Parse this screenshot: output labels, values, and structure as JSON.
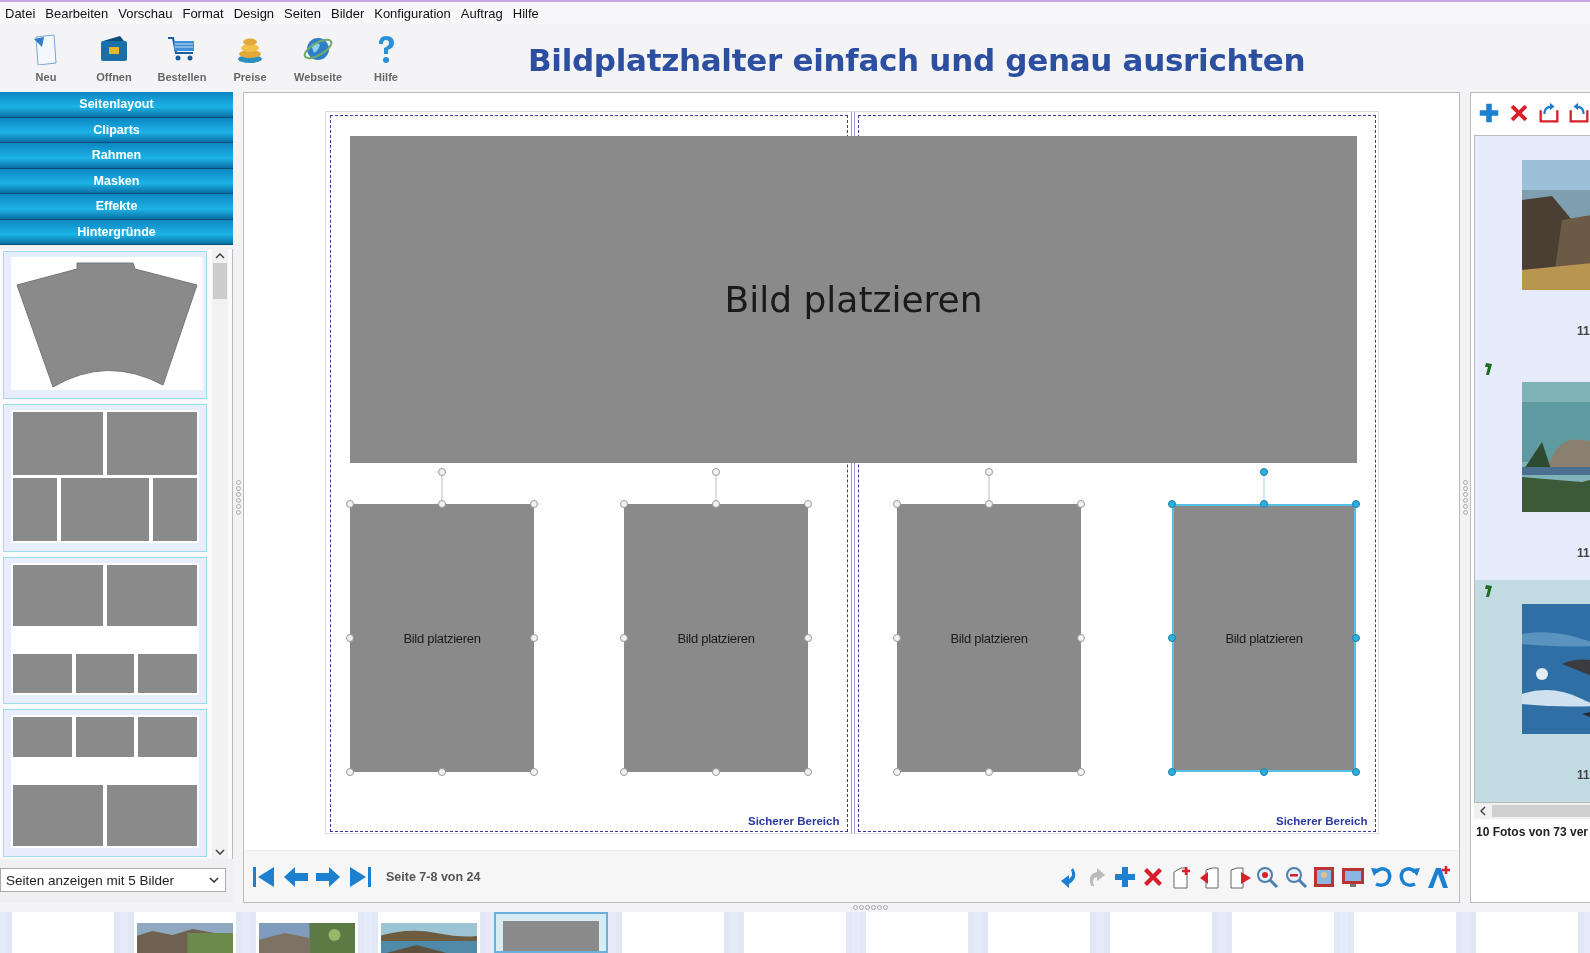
{
  "menu": [
    "Datei",
    "Bearbeiten",
    "Vorschau",
    "Format",
    "Design",
    "Seiten",
    "Bilder",
    "Konfiguration",
    "Auftrag",
    "Hilfe"
  ],
  "toolbar": [
    {
      "kind": "new",
      "label": "Neu"
    },
    {
      "kind": "open",
      "label": "Offnen"
    },
    {
      "kind": "order",
      "label": "Bestellen"
    },
    {
      "kind": "prices",
      "label": "Preise"
    },
    {
      "kind": "web",
      "label": "Webseite"
    },
    {
      "kind": "help",
      "label": "Hilfe"
    }
  ],
  "headline": "Bildplatzhalter einfach und genau ausrichten",
  "sidebar": {
    "sections": [
      "Seitenlayout",
      "Cliparts",
      "Rahmen",
      "Masken",
      "Effekte",
      "Hintergründe"
    ],
    "layouts": [
      {
        "kind": "fan"
      },
      {
        "kind": "two-over-three"
      },
      {
        "kind": "two-over-three-small"
      },
      {
        "kind": "three-over-two"
      }
    ],
    "page_filter": {
      "value": "Seiten anzeigen mit 5 Bilder"
    }
  },
  "canvas": {
    "placeholders": [
      {
        "kind": "large",
        "text": "Bild platzieren",
        "selected": false
      },
      {
        "kind": "small",
        "text": "Bild platzieren",
        "selected": false
      },
      {
        "kind": "small",
        "text": "Bild platzieren",
        "selected": false
      },
      {
        "kind": "small",
        "text": "Bild platzieren",
        "selected": false
      },
      {
        "kind": "small",
        "text": "Bild platzieren",
        "selected": true
      }
    ],
    "safe_area_labels": [
      "Sicherer Bereich",
      "Sicherer Bereich"
    ],
    "page_indicator": "Seite 7-8 von 24"
  },
  "photos": {
    "items": [
      {
        "caption": "11",
        "flagged": false,
        "selected": false
      },
      {
        "caption": "11",
        "flagged": true,
        "selected": false
      },
      {
        "caption": "11",
        "flagged": true,
        "selected": true
      }
    ],
    "status": "10 Fotos von 73 ver"
  },
  "filmstrip": [
    {
      "kind": "blank",
      "selected": false
    },
    {
      "kind": "picture",
      "selected": false
    },
    {
      "kind": "picture",
      "selected": false
    },
    {
      "kind": "picture",
      "selected": false
    },
    {
      "kind": "layout",
      "selected": true
    },
    {
      "kind": "blank",
      "selected": false
    },
    {
      "kind": "blank",
      "selected": false
    },
    {
      "kind": "blank",
      "selected": false
    },
    {
      "kind": "blank",
      "selected": false
    },
    {
      "kind": "blank",
      "selected": false
    },
    {
      "kind": "blank",
      "selected": false
    },
    {
      "kind": "blank",
      "selected": false
    },
    {
      "kind": "blank",
      "selected": false
    }
  ]
}
